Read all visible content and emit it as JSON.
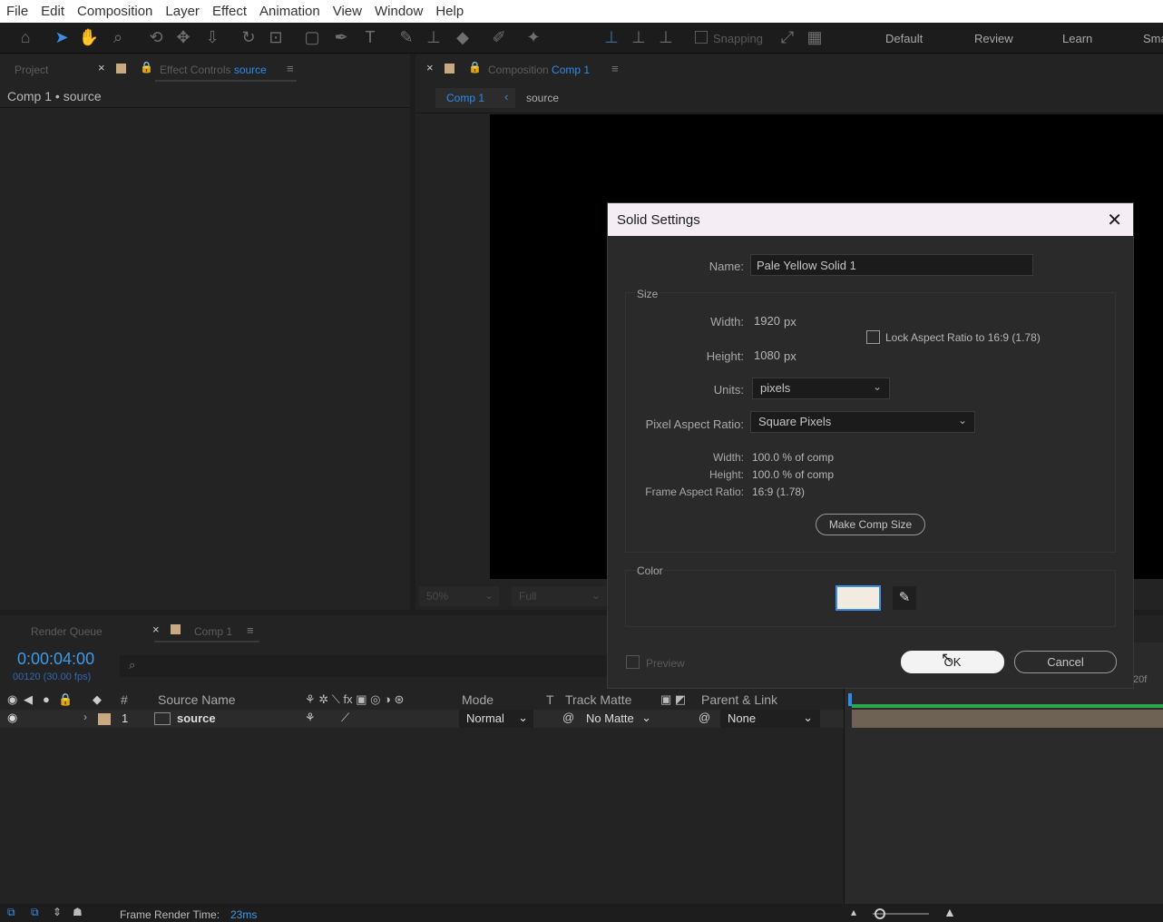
{
  "menu": [
    "File",
    "Edit",
    "Composition",
    "Layer",
    "Effect",
    "Animation",
    "View",
    "Window",
    "Help"
  ],
  "toolbar": {
    "snapping": "Snapping",
    "workspaces": [
      "Default",
      "Review",
      "Learn",
      "Sma"
    ]
  },
  "left_panel": {
    "tab_project": "Project",
    "tab_effect_controls": "Effect Controls",
    "tab_effect_controls_target": "source",
    "header": "Comp 1 • source"
  },
  "comp_panel": {
    "tab_label": "Composition",
    "tab_target": "Comp 1",
    "breadcrumb_comp": "Comp 1",
    "breadcrumb_source": "source",
    "zoom": "50%",
    "resolution": "Full"
  },
  "dialog": {
    "title": "Solid Settings",
    "name_label": "Name:",
    "name_value": "Pale Yellow Solid 1",
    "size_group": "Size",
    "width_label": "Width:",
    "width_value": "1920",
    "width_unit": "px",
    "height_label": "Height:",
    "height_value": "1080",
    "height_unit": "px",
    "lock_label": "Lock Aspect Ratio to 16:9 (1.78)",
    "units_label": "Units:",
    "units_value": "pixels",
    "par_label": "Pixel Aspect Ratio:",
    "par_value": "Square Pixels",
    "pct_width_label": "Width:",
    "pct_width_value": "100.0 % of comp",
    "pct_height_label": "Height:",
    "pct_height_value": "100.0 % of comp",
    "far_label": "Frame Aspect Ratio:",
    "far_value": "16:9 (1.78)",
    "make_comp_size": "Make Comp Size",
    "color_group": "Color",
    "swatch_color": "#f2ebe0",
    "preview_label": "Preview",
    "ok_label": "OK",
    "cancel_label": "Cancel"
  },
  "timeline": {
    "tab_render_queue": "Render Queue",
    "tab_comp": "Comp 1",
    "timecode": "0:00:04:00",
    "frames": "00120 (30.00 fps)",
    "col_number": "#",
    "col_source_name": "Source Name",
    "col_mode": "Mode",
    "col_t": "T",
    "col_track_matte": "Track Matte",
    "col_parent": "Parent & Link",
    "layer": {
      "index": "1",
      "name": "source",
      "mode": "Normal",
      "matte": "No Matte",
      "parent": "None"
    },
    "ruler_label": "20f"
  },
  "status": {
    "render_time_label": "Frame Render Time:",
    "render_time_value": "23ms"
  }
}
